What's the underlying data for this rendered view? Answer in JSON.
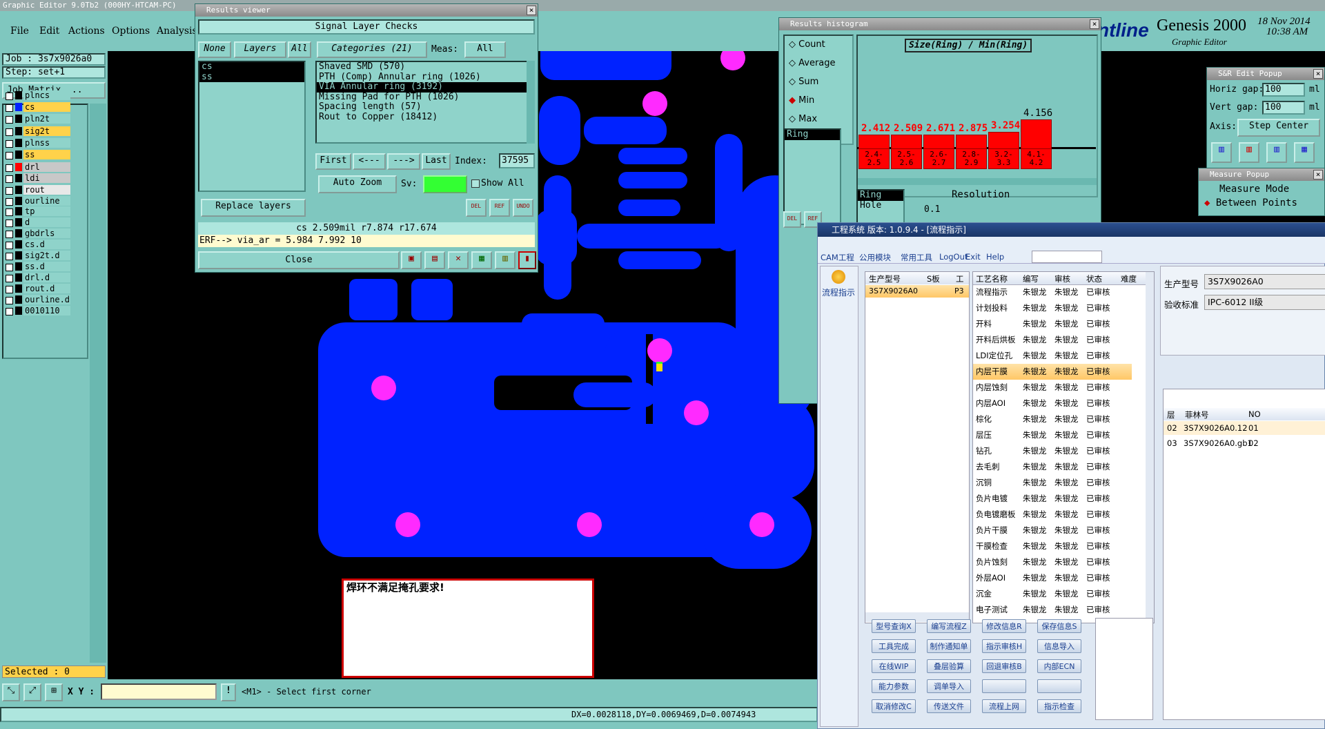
{
  "app": {
    "title": "Graphic Editor 9.0Tb2  (000HY-HTCAM-PC)",
    "brand1": "Genesis 2000",
    "brand2": "Graphic Editor",
    "date": "18 Nov 2014",
    "time": "10:38 AM",
    "frontline": "ntline"
  },
  "menu": [
    "File",
    "Edit",
    "Actions",
    "Options",
    "Analysis"
  ],
  "left": {
    "job": "Job : 3s7x9026a0",
    "step": "Step: set+1",
    "matrix": "Job Matrix ...",
    "selected": "Selected : 0",
    "layers": [
      {
        "n": "plncs",
        "c": "#ffffff",
        "bg": "#8fd3ca"
      },
      {
        "n": "cs",
        "c": "#0022ff",
        "bg": "#ffd24a"
      },
      {
        "n": "pln2t",
        "c": "#ffffff",
        "bg": "#8fd3ca"
      },
      {
        "n": "sig2t",
        "c": "#ffffff",
        "bg": "#ffd24a"
      },
      {
        "n": "plnss",
        "c": "#ffffff",
        "bg": "#8fd3ca"
      },
      {
        "n": "ss",
        "c": "#ffffff",
        "bg": "#ffd24a"
      },
      {
        "n": "drl",
        "c": "#ff0000",
        "bg": "#c8c8c8"
      },
      {
        "n": "ldi",
        "c": "#ffffff",
        "bg": "#c8c8c8"
      },
      {
        "n": "rout",
        "c": "#ffffff",
        "bg": "#e8e8e8"
      },
      {
        "n": "ourline",
        "c": "#ffffff",
        "bg": "#8fd3ca"
      },
      {
        "n": "tp",
        "c": "#ffffff",
        "bg": "#8fd3ca"
      },
      {
        "n": "d",
        "c": "#ffffff",
        "bg": "#8fd3ca"
      },
      {
        "n": "gbdrls",
        "c": "#ffffff",
        "bg": "#8fd3ca"
      },
      {
        "n": "cs.d",
        "c": "#ffffff",
        "bg": "#8fd3ca"
      },
      {
        "n": "sig2t.d",
        "c": "#ffffff",
        "bg": "#8fd3ca"
      },
      {
        "n": "ss.d",
        "c": "#ffffff",
        "bg": "#8fd3ca"
      },
      {
        "n": "drl.d",
        "c": "#ffffff",
        "bg": "#8fd3ca"
      },
      {
        "n": "rout.d",
        "c": "#ffffff",
        "bg": "#8fd3ca"
      },
      {
        "n": "ourline.d",
        "c": "#ffffff",
        "bg": "#8fd3ca"
      },
      {
        "n": "0010110",
        "c": "#ffffff",
        "bg": "#8fd3ca"
      }
    ]
  },
  "bottom": {
    "xy": "X Y :",
    "hint": "<M1> - Select first corner",
    "dx": "DX=0.0028118,DY=0.0069469,D=0.0074943"
  },
  "results": {
    "title": "Results viewer",
    "heading": "Signal Layer Checks",
    "none": "None",
    "layers": "Layers",
    "all": "All",
    "categories": "Categories (21)",
    "meas": "Meas:",
    "meas_val": "All",
    "layer_items": [
      "cs",
      "ss"
    ],
    "items": [
      "Shaved SMD (570)",
      "PTH (Comp) Annular ring (1026)",
      "VIA Annular ring (3192)",
      "Missing Pad for PTH (1026)",
      "Spacing length (57)",
      "Rout to Copper (18412)"
    ],
    "first": "First",
    "prev": "<---",
    "next": "--->",
    "last": "Last",
    "index_label": "Index:",
    "index": "37595",
    "autozoom": "Auto Zoom",
    "sv": "Sv:",
    "showall": "Show All",
    "replace": "Replace layers",
    "del": "DEL",
    "ref": "REF",
    "undo": "UNDO",
    "status": "cs 2.509mil   r7.874  r17.674",
    "erf": "ERF--> via_ar = 5.984 7.992 10",
    "close": "Close"
  },
  "histogram": {
    "title": "Results histogram",
    "heading": "Size(Ring) / Min(Ring)",
    "modes": [
      "Count",
      "Average",
      "Sum",
      "Min",
      "Max"
    ],
    "ring": "Ring",
    "list": [
      "Ring",
      "Hole"
    ],
    "resolution": "Resolution",
    "res_val": "0.1",
    "del": "DEL",
    "ref": "REF",
    "bars": [
      {
        "v": "2.412",
        "r": "2.4-\n2.5",
        "h": 0.38
      },
      {
        "v": "2.509",
        "r": "2.5-\n2.6",
        "h": 0.38
      },
      {
        "v": "2.671",
        "r": "2.6-\n2.7",
        "h": 0.38
      },
      {
        "v": "2.875",
        "r": "2.8-\n2.9",
        "h": 0.38
      },
      {
        "v": "3.254",
        "r": "3.2-\n3.3",
        "h": 0.5
      },
      {
        "v": "4.156",
        "r": "4.1-\n4.2",
        "h": 1.0
      }
    ]
  },
  "sr": {
    "title": "S&R Edit Popup",
    "hgap": "Horiz gap:",
    "hval": "100",
    "vgap": "Vert  gap:",
    "vval": "100",
    "unit": "ml",
    "axis": "Axis:",
    "axis_val": "Step Center"
  },
  "measure": {
    "title": "Measure Popup",
    "mode": "Measure Mode",
    "between": "Between Points"
  },
  "message": "焊环不满足掩孔要求!",
  "cn": {
    "title": "工程系统    版本: 1.0.9.4 - [流程指示]",
    "menu": [
      "CAM工程",
      "公用模块",
      "常用工具",
      "LogOut",
      "Exit",
      "Help"
    ],
    "nav": "流程指示",
    "left_cols": [
      "生产型号",
      "S板",
      "工"
    ],
    "left_row": [
      "3S7X9026A0",
      "",
      "P3"
    ],
    "cols": [
      "工艺名称",
      "编写",
      "审核",
      "状态",
      "难度"
    ],
    "rows": [
      "流程指示",
      "计划投料",
      "开料",
      "开料后烘板",
      "LDI定位孔",
      "内层干膜",
      "内层蚀刻",
      "内层AOI",
      "棕化",
      "层压",
      "钻孔",
      "去毛刺",
      "沉铜",
      "负片电镀",
      "负电镀磨板",
      "负片干膜",
      "干膜检查",
      "负片蚀刻",
      "外层AOI",
      "沉金",
      "电子测试"
    ],
    "writer": "朱银龙",
    "reviewer": "朱银龙",
    "state": "已审核",
    "buttons": [
      [
        "型号查询X",
        "编写流程Z",
        "修改信息R",
        "保存信息S"
      ],
      [
        "工具完成",
        "制作通知单",
        "指示审核H",
        "信息导入"
      ],
      [
        "在线WIP",
        "叠层验算",
        "回退审核B",
        "内部ECN"
      ],
      [
        "能力参数",
        "调单导入",
        "",
        ""
      ],
      [
        "取消修改C",
        "传送文件",
        "流程上网",
        "指示检查"
      ]
    ],
    "model_label": "生产型号",
    "model": "3S7X9026A0",
    "std_label": "验收标准",
    "std": "IPC-6012 II级",
    "film_cols": [
      "层",
      "菲林号",
      "NO"
    ],
    "films": [
      [
        "02",
        "3S7X9026A0.12",
        "01"
      ],
      [
        "03",
        "3S7X9026A0.gb1",
        "02"
      ]
    ]
  }
}
